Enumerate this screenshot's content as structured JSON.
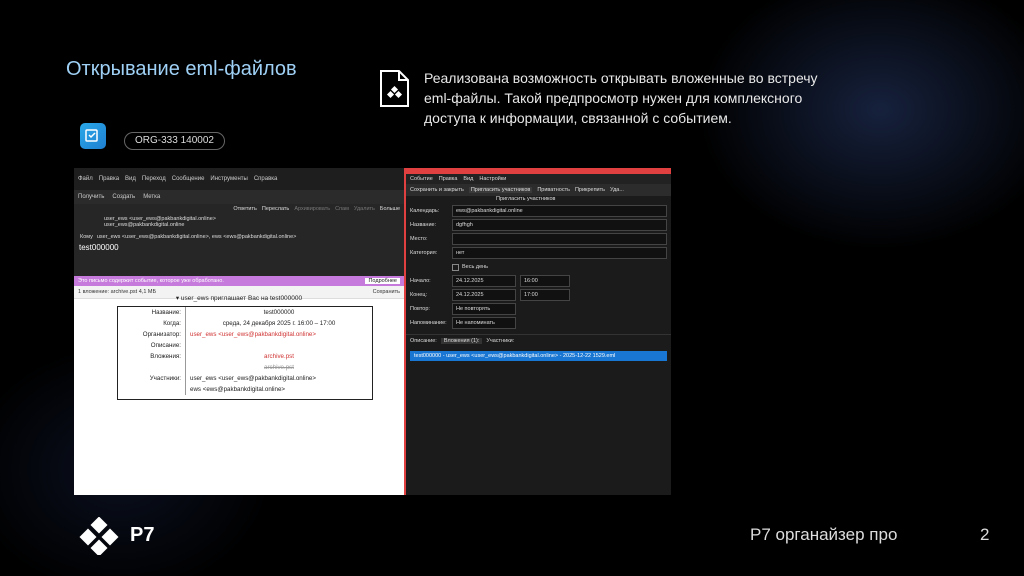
{
  "slide": {
    "title": "Открывание eml-файлов",
    "description": "Реализована возможность открывать вложенные во встречу eml-файлы. Такой предпросмотр нужен для комплексного доступа к информации, связанной с событием.",
    "badge": "ORG-333 140002",
    "logo_text": "Р7",
    "footer_product": "Р7 органайзер про",
    "page_number": "2"
  },
  "mail_window": {
    "menu": [
      "Файл",
      "Правка",
      "Вид",
      "Переход",
      "Сообщение",
      "Инструменты",
      "Справка"
    ],
    "toolbar": [
      "Получить",
      "Создать",
      "Метка"
    ],
    "actions": [
      "Ответить",
      "Переслать",
      "Архивировать",
      "Спам",
      "Удалить",
      "Больше"
    ],
    "from": "user_ews <user_ews@pakbankdigital.online>",
    "from_email": "user_ews@pakbankdigital.online",
    "to_label": "Кому",
    "to": "user_ews <user_ews@pakbankdigital.online>, ews <ews@pakbankdigital.online>",
    "subject": "test000000",
    "notice": "Это письмо содержит событие, которое уже обработано.",
    "notice_button": "Подробнее",
    "attachment_summary": "1 вложение: archive.pst  4,1 МБ",
    "save_label": "Сохранить",
    "invite_title": "▾ user_ews приглашает Вас на test000000",
    "invite": [
      {
        "k": "Название:",
        "v": "test000000"
      },
      {
        "k": "Когда:",
        "v": "среда, 24 декабря 2025 г. 16:00 – 17:00"
      },
      {
        "k": "Организатор:",
        "v": "user_ews <user_ews@pakbankdigital.online>"
      },
      {
        "k": "Описание:",
        "v": ""
      },
      {
        "k": "Вложения:",
        "v": "archive.pst"
      },
      {
        "k": "",
        "v": "archive.pst"
      },
      {
        "k": "Участники:",
        "v": "user_ews <user_ews@pakbankdigital.online>"
      },
      {
        "k": "",
        "v": "ews <ews@pakbankdigital.online>"
      }
    ]
  },
  "event_window": {
    "menu": [
      "Событие",
      "Правка",
      "Вид",
      "Настройки"
    ],
    "toolbar": [
      "Сохранить и закрыть",
      "Пригласить участников",
      "Приватность",
      "Прикрепить",
      "Уда..."
    ],
    "tooltip": "Пригласить участников",
    "calendar_label": "Календарь:",
    "calendar_value": "ews@pakbankdigital.online",
    "name_label": "Название:",
    "name_value": "dgfhgh",
    "place_label": "Место:",
    "category_label": "Категория:",
    "category_value": "нет",
    "allday_label": "Весь день",
    "start_label": "Начало:",
    "start_date": "24.12.2025",
    "start_time": "16:00",
    "end_label": "Конец:",
    "end_date": "24.12.2025",
    "end_time": "17:00",
    "repeat_label": "Повтор:",
    "repeat_value": "Не повторять",
    "reminder_label": "Напоминание:",
    "reminder_value": "Не напоминать",
    "tabs": [
      "Описание:",
      "Вложения (1):",
      "Участники:"
    ],
    "attachment_item": "test000000 - user_ews <user_ews@pakbankdigital.online> - 2025-12-22 1529.eml"
  }
}
